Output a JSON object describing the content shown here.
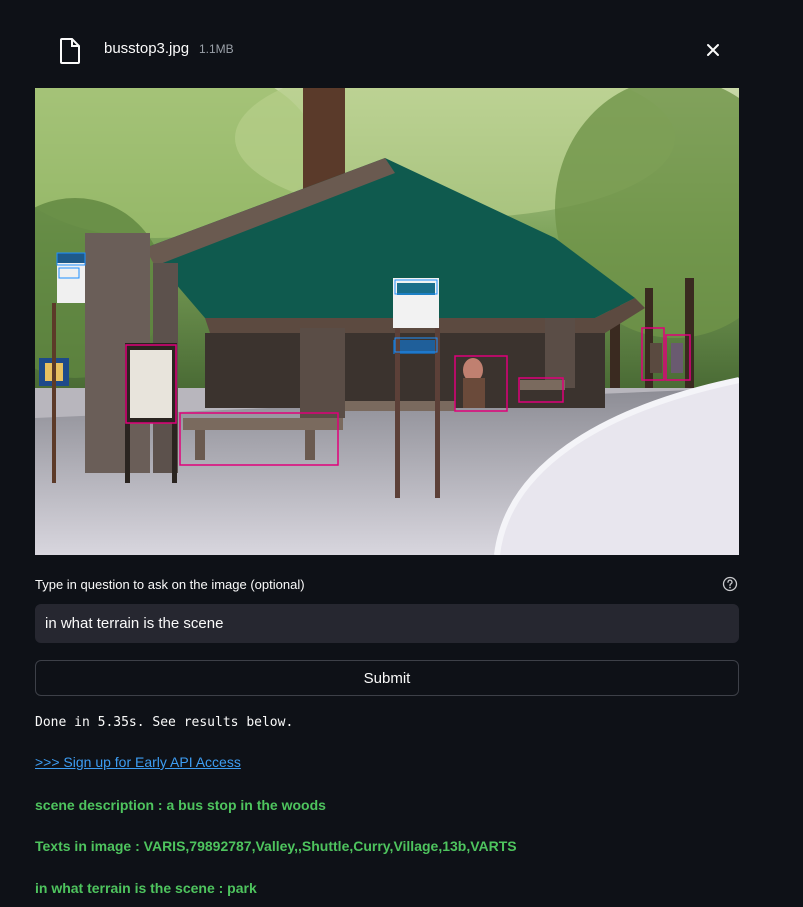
{
  "file": {
    "name": "busstop3.jpg",
    "size": "1.1MB",
    "icon": "file-icon",
    "close_icon": "close-icon"
  },
  "image": {
    "alt": "Bus stop shelter in a wooded area with detection boxes",
    "box_color": "#e0007a",
    "text_box_color": "#1e90ff"
  },
  "question": {
    "label": "Type in question to ask on the image (optional)",
    "help_icon": "help-circle-icon",
    "value": "in what terrain is the scene"
  },
  "submit_label": "Submit",
  "status_text": "Done in 5.35s. See results below.",
  "api_link_text": ">>> Sign up for Early API Access",
  "results": [
    "scene description : a bus stop in the woods",
    "Texts in image : VARIS,79892787,Valley,,Shuttle,Curry,Village,13b,VARTS",
    "in what terrain is the scene : park"
  ],
  "colors": {
    "background": "#0e1117",
    "result_green": "#4ec45e",
    "link_blue": "#3d9df3",
    "input_bg": "#262730"
  }
}
